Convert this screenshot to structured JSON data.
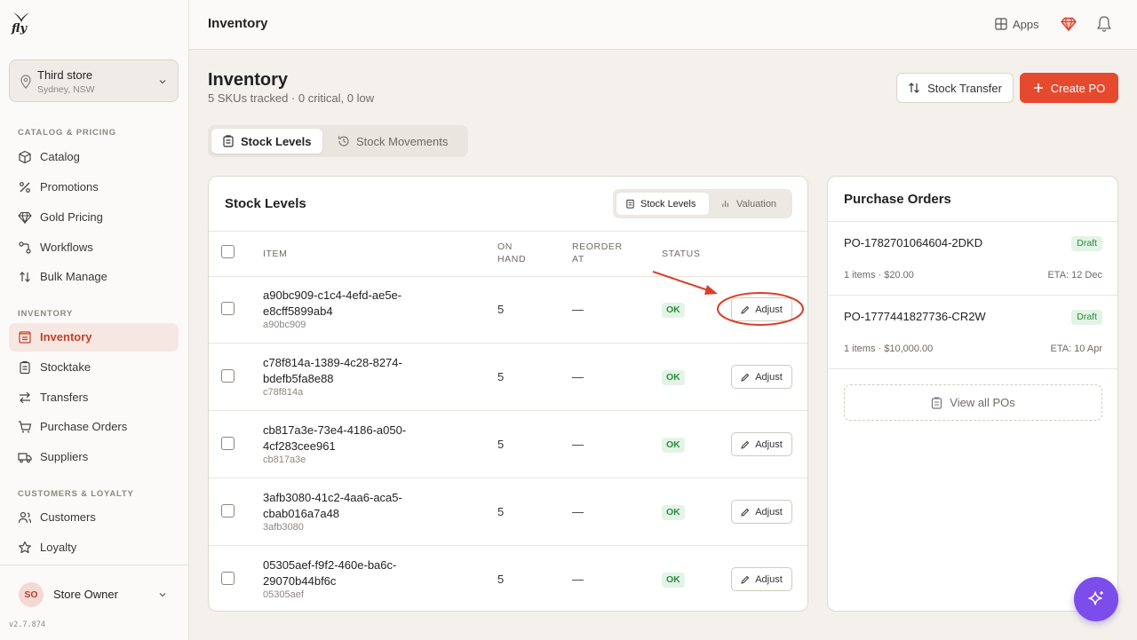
{
  "app": {
    "logo_text": "fly",
    "version": "v2.7.874"
  },
  "store": {
    "name": "Third store",
    "location": "Sydney, NSW"
  },
  "sidebar": {
    "sections": [
      {
        "label": "CATALOG & PRICING"
      },
      {
        "label": "INVENTORY"
      },
      {
        "label": "CUSTOMERS & LOYALTY"
      }
    ],
    "items": [
      {
        "label": "Catalog",
        "icon": "box-icon"
      },
      {
        "label": "Promotions",
        "icon": "percent-icon"
      },
      {
        "label": "Gold Pricing",
        "icon": "gem-icon"
      },
      {
        "label": "Workflows",
        "icon": "workflow-icon"
      },
      {
        "label": "Bulk Manage",
        "icon": "sort-arrows-icon"
      },
      {
        "label": "Inventory",
        "icon": "inventory-icon",
        "active": true
      },
      {
        "label": "Stocktake",
        "icon": "clipboard-icon"
      },
      {
        "label": "Transfers",
        "icon": "transfer-icon"
      },
      {
        "label": "Purchase Orders",
        "icon": "cart-icon"
      },
      {
        "label": "Suppliers",
        "icon": "truck-icon"
      },
      {
        "label": "Customers",
        "icon": "users-icon"
      },
      {
        "label": "Loyalty",
        "icon": "star-icon"
      }
    ]
  },
  "user": {
    "initials": "SO",
    "name": "Store Owner"
  },
  "topbar": {
    "title": "Inventory",
    "apps_label": "Apps"
  },
  "header": {
    "title": "Inventory",
    "subtitle": "5 SKUs tracked · 0 critical, 0 low",
    "stock_transfer_label": "Stock Transfer",
    "create_po_label": "Create PO"
  },
  "tabs": [
    {
      "label": "Stock Levels",
      "active": true
    },
    {
      "label": "Stock Movements",
      "active": false
    }
  ],
  "stock_card": {
    "title": "Stock Levels",
    "segments": [
      {
        "label": "Stock Levels",
        "active": true
      },
      {
        "label": "Valuation",
        "active": false
      }
    ],
    "columns": {
      "item": "ITEM",
      "on_hand": "ON HAND",
      "reorder_at": "REORDER AT",
      "status": "STATUS"
    },
    "adjust_label": "Adjust",
    "rows": [
      {
        "name": "a90bc909-c1c4-4efd-ae5e-e8cff5899ab4",
        "sku": "a90bc909",
        "on_hand": "5",
        "reorder_at": "—",
        "status": "OK"
      },
      {
        "name": "c78f814a-1389-4c28-8274-bdefb5fa8e88",
        "sku": "c78f814a",
        "on_hand": "5",
        "reorder_at": "—",
        "status": "OK"
      },
      {
        "name": "cb817a3e-73e4-4186-a050-4cf283cee961",
        "sku": "cb817a3e",
        "on_hand": "5",
        "reorder_at": "—",
        "status": "OK"
      },
      {
        "name": "3afb3080-41c2-4aa6-aca5-cbab016a7a48",
        "sku": "3afb3080",
        "on_hand": "5",
        "reorder_at": "—",
        "status": "OK"
      },
      {
        "name": "05305aef-f9f2-460e-ba6c-29070b44bf6c",
        "sku": "05305aef",
        "on_hand": "5",
        "reorder_at": "—",
        "status": "OK"
      }
    ]
  },
  "purchase_orders": {
    "title": "Purchase Orders",
    "items": [
      {
        "id": "PO-1782701064604-2DKD",
        "status": "Draft",
        "meta": "1 items · $20.00",
        "eta": "ETA: 12 Dec"
      },
      {
        "id": "PO-1777441827736-CR2W",
        "status": "Draft",
        "meta": "1 items · $10,000.00",
        "eta": "ETA: 10 Apr"
      }
    ],
    "view_all_label": "View all POs"
  },
  "colors": {
    "accent": "#e64a2e",
    "active_nav_bg": "#f7e7e2",
    "ok_green": "#2d8a3e",
    "fab": "#7c4dea"
  }
}
